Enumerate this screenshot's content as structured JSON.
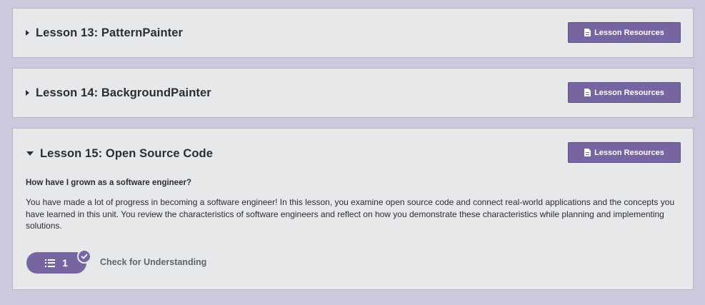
{
  "lessons": [
    {
      "title": "Lesson 13: PatternPainter",
      "expanded": false,
      "resources_label": "Lesson Resources"
    },
    {
      "title": "Lesson 14: BackgroundPainter",
      "expanded": false,
      "resources_label": "Lesson Resources"
    },
    {
      "title": "Lesson 15: Open Source Code",
      "expanded": true,
      "resources_label": "Lesson Resources",
      "question": "How have I grown as a software engineer?",
      "description": "You have made a lot of progress in becoming a software engineer! In this lesson, you examine open source code and connect real-world applications and the concepts you have learned in this unit. You review the characteristics of software engineers and reflect on how you demonstrate these characteristics while planning and implementing solutions.",
      "activity": {
        "count": "1",
        "label": "Check for Understanding",
        "completed": true
      }
    }
  ],
  "colors": {
    "background": "#cdc8de",
    "card": "#e7e8ea",
    "accent": "#7665a0",
    "text": "#292f36"
  },
  "icons": {
    "collapsed": "caret-right-icon",
    "expanded": "caret-down-icon",
    "resources": "document-icon",
    "activity": "list-icon",
    "completed": "check-icon"
  }
}
